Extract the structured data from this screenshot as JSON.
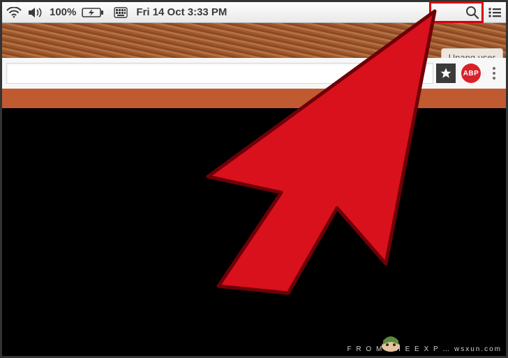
{
  "menubar": {
    "battery_pct": "100%",
    "datetime": "Fri 14 Oct  3:33 PM"
  },
  "tabstrip": {
    "user_label": "Unang user"
  },
  "addrbar": {
    "abp_label": "ABP"
  },
  "watermark": "F R O M   T H E   E X P … wsxun.com",
  "icons": {
    "wifi": "wifi-icon",
    "sound": "volume-icon",
    "power": "charging-icon",
    "input": "input-source-icon",
    "spotlight": "search-icon",
    "hamburger": "sidebar-menu-icon",
    "star": "bookmark-star-icon",
    "abp": "adblock-plus-badge",
    "chrome_menu": "chrome-menu-icon"
  }
}
